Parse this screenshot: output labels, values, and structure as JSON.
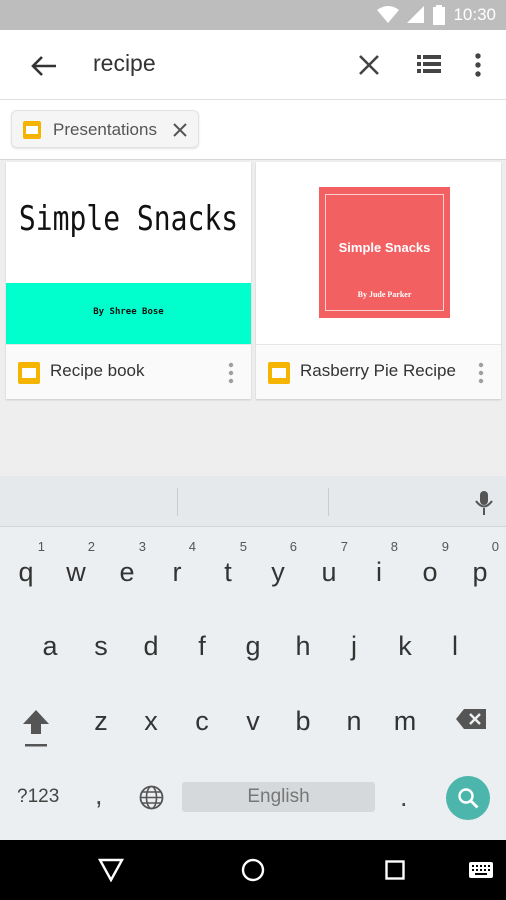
{
  "status_bar": {
    "time": "10:30"
  },
  "search": {
    "query": "recipe"
  },
  "filter": {
    "chip_label": "Presentations"
  },
  "results": [
    {
      "title": "Recipe book",
      "thumbnail_title": "Simple Snacks",
      "thumbnail_subtitle": "By Shree Bose",
      "band_color": "#00ffcc"
    },
    {
      "title": "Rasberry Pie Recipe",
      "thumbnail_title": "Simple Snacks",
      "thumbnail_subtitle": "By Jude Parker",
      "box_color": "#f36062"
    }
  ],
  "keyboard": {
    "row1": [
      {
        "key": "q",
        "hint": "1"
      },
      {
        "key": "w",
        "hint": "2"
      },
      {
        "key": "e",
        "hint": "3"
      },
      {
        "key": "r",
        "hint": "4"
      },
      {
        "key": "t",
        "hint": "5"
      },
      {
        "key": "y",
        "hint": "6"
      },
      {
        "key": "u",
        "hint": "7"
      },
      {
        "key": "i",
        "hint": "8"
      },
      {
        "key": "o",
        "hint": "9"
      },
      {
        "key": "p",
        "hint": "0"
      }
    ],
    "row2": [
      "a",
      "s",
      "d",
      "f",
      "g",
      "h",
      "j",
      "k",
      "l"
    ],
    "row3": [
      "z",
      "x",
      "c",
      "v",
      "b",
      "n",
      "m"
    ],
    "symbols_label": "?123",
    "comma": ",",
    "period": ".",
    "space_label": "English"
  },
  "colors": {
    "accent": "#4db6ac",
    "slides_icon": "#f4b400"
  }
}
